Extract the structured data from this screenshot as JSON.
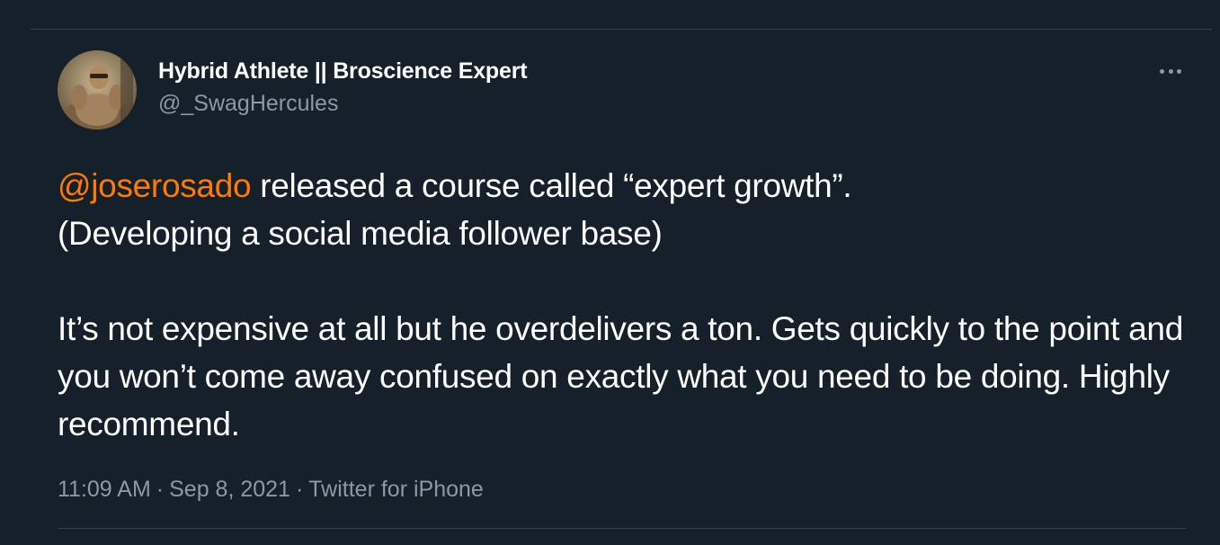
{
  "author": {
    "display_name": "Hybrid Athlete || Broscience Expert",
    "handle": "@_SwagHercules",
    "avatar_icon": "user-avatar"
  },
  "tweet": {
    "paragraph1": {
      "mention": "@joserosado",
      "line1_rest": " released a course called “expert growth”.",
      "line2": "(Developing a social media follower base)"
    },
    "paragraph2": "It’s not expensive at all but he overdelivers a ton. Gets quickly to the point and you won’t come away confused on exactly what you need to be doing. Highly recommend."
  },
  "meta": {
    "time": "11:09 AM",
    "date": "Sep 8, 2021",
    "source": "Twitter for iPhone",
    "separator": "·"
  },
  "colors": {
    "background": "#15202b",
    "mention": "#ff7a00",
    "secondary_text": "#8b98a5",
    "divider": "#38444d"
  },
  "icons": {
    "more": "more-horizontal-icon"
  }
}
